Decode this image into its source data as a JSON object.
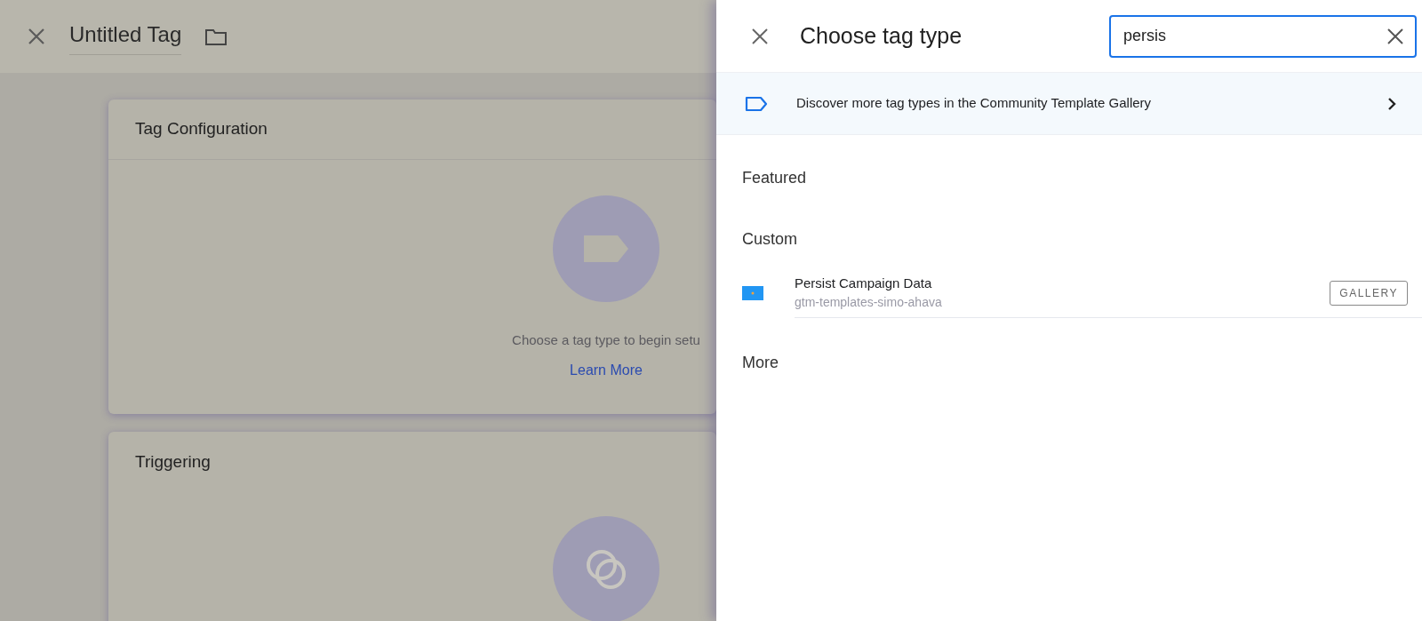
{
  "editor": {
    "title": "Untitled Tag",
    "cards": [
      {
        "kind": "tag",
        "title": "Tag Configuration",
        "hint": "Choose a tag type to begin setu",
        "link": "Learn More"
      },
      {
        "kind": "trigger",
        "title": "Triggering"
      }
    ]
  },
  "panel": {
    "title": "Choose tag type",
    "search": {
      "value": "persis"
    },
    "banner": "Discover more tag types in the Community Template Gallery",
    "sections": [
      {
        "heading": "Featured"
      },
      {
        "heading": "Custom",
        "items": [
          {
            "name": "Persist Campaign Data",
            "author": "gtm-templates-simo-ahava",
            "badge": "GALLERY"
          }
        ]
      },
      {
        "heading": "More"
      }
    ]
  }
}
